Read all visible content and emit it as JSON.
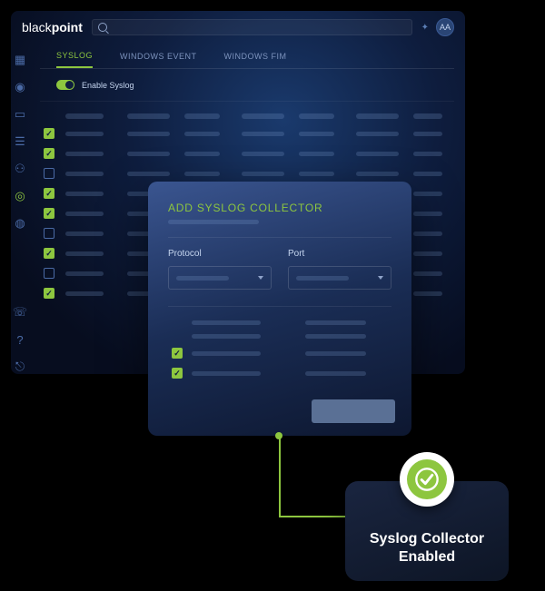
{
  "brand": {
    "light": "black",
    "bold": "point"
  },
  "avatar": "AA",
  "tabs": [
    {
      "label": "SYSLOG",
      "active": true
    },
    {
      "label": "WINDOWS EVENT",
      "active": false
    },
    {
      "label": "WINDOWS FIM",
      "active": false
    }
  ],
  "enable_toggle_label": "Enable Syslog",
  "table_rows_checked": [
    true,
    true,
    false,
    true,
    true,
    false,
    true,
    false,
    true
  ],
  "modal": {
    "title": "ADD SYSLOG COLLECTOR",
    "fields": {
      "protocol_label": "Protocol",
      "port_label": "Port"
    },
    "option_rows_checked": [
      null,
      null,
      true,
      true
    ]
  },
  "result": {
    "line1": "Syslog Collector",
    "line2": "Enabled"
  },
  "colors": {
    "accent": "#8dc63f",
    "bg_deep": "#070d1f"
  }
}
